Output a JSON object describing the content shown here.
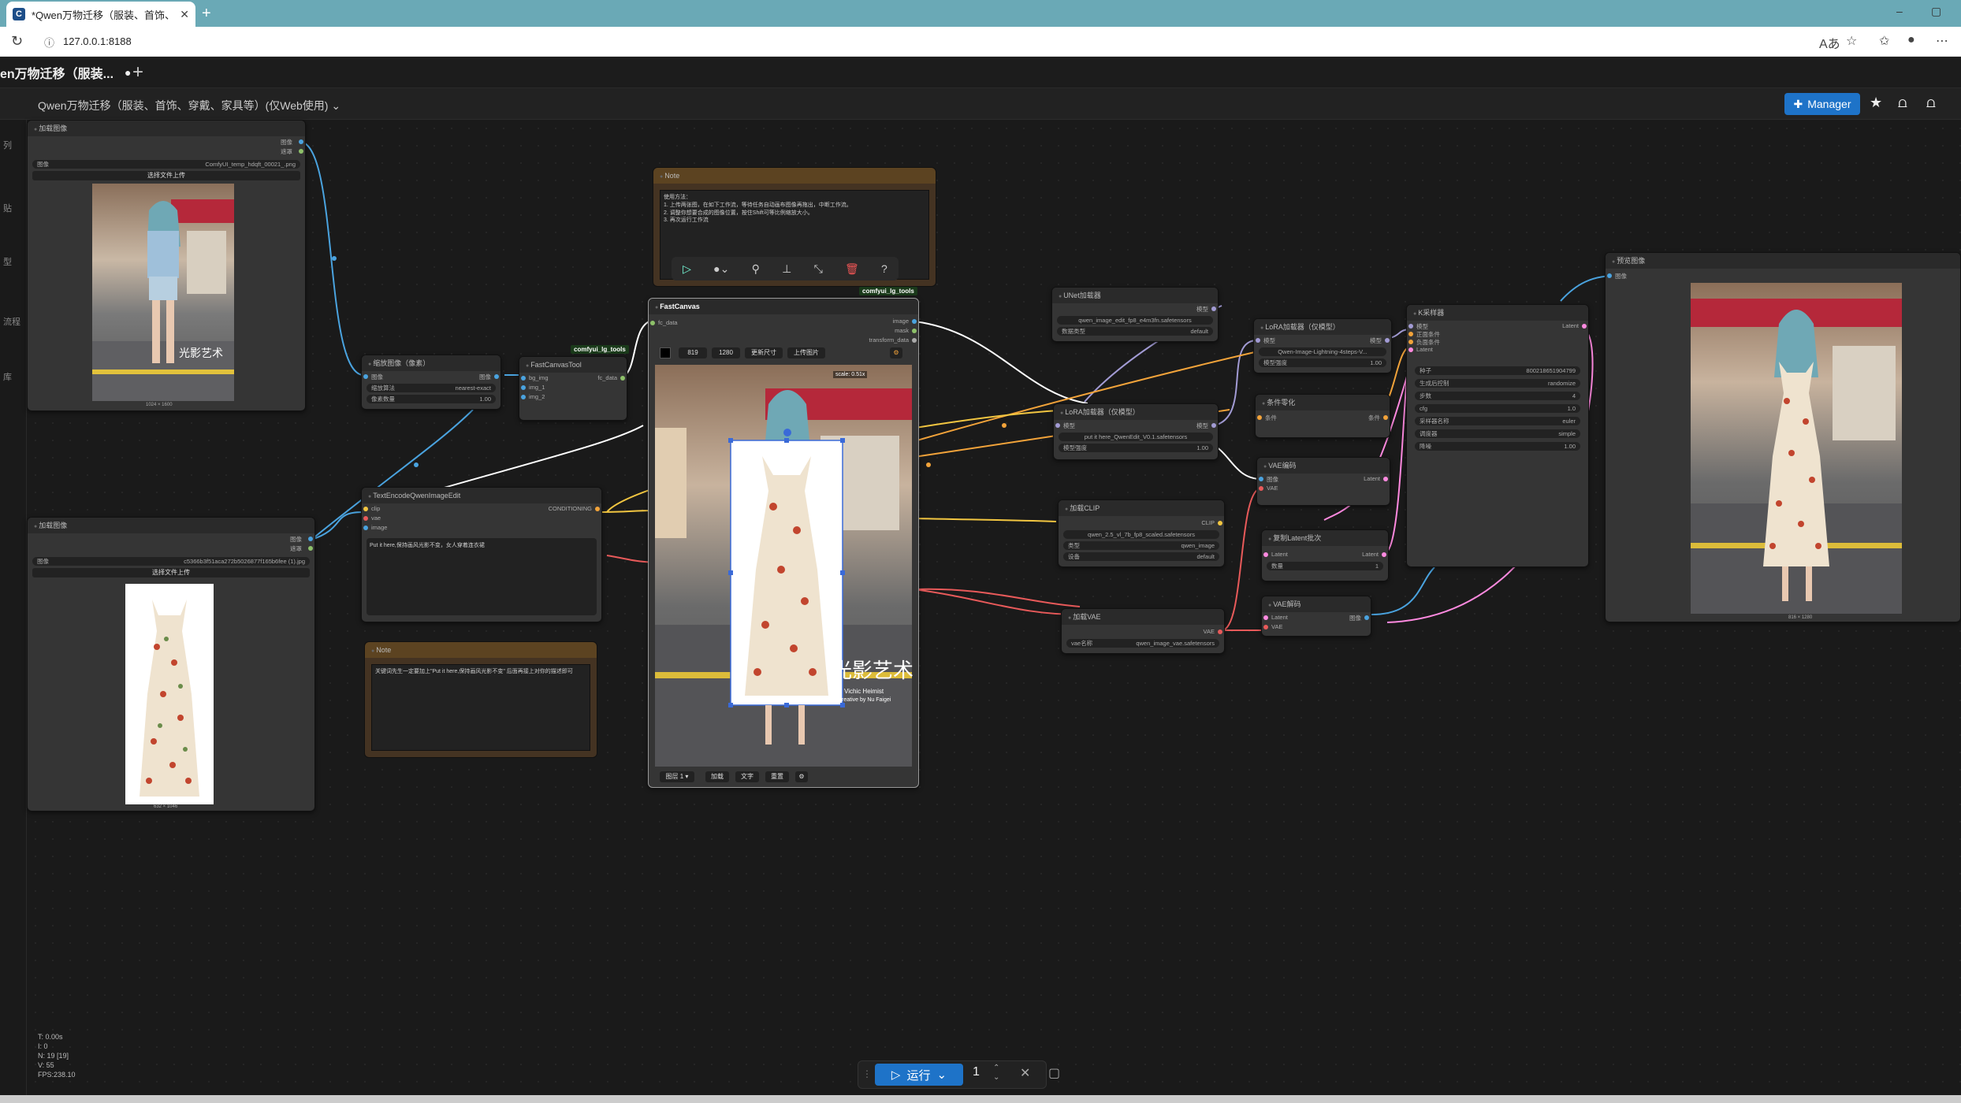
{
  "browser": {
    "tab_title": "*Qwen万物迁移（服装、首饰、多",
    "tab_icon": "C",
    "url": "127.0.0.1:8188",
    "new_tab": "+",
    "close": "✕",
    "minimize": "–",
    "maximize": "▢"
  },
  "app": {
    "workflow_tab": "en万物迁移（服装...",
    "workflow_tab_dot": "●",
    "add_tab": "+",
    "workflow_title": "Qwen万物迁移（服装、首饰、穿戴、家具等）(仅Web使用) ⌄",
    "manager_label": "Manager",
    "left_icons": [
      "列",
      "贴",
      "型",
      "流程",
      "库"
    ],
    "colors": {
      "accent": "#1e73c8",
      "canvas": "#1a1a1a",
      "node": "#353535"
    }
  },
  "nodes": {
    "load1": {
      "title": "加载图像",
      "out1": "图像",
      "out2": "遮罩",
      "file_label": "图像",
      "file": "ComfyUI_temp_hdqft_00021_.png",
      "upload": "选择文件上传",
      "dims": "1024 × 1600"
    },
    "load2": {
      "title": "加载图像",
      "out1": "图像",
      "out2": "遮罩",
      "file_label": "图像",
      "file": "c5366b3f51aca272b5026877f165b6fee (1).jpg",
      "upload": "选择文件上传",
      "dims": "632 × 1046"
    },
    "scale": {
      "title": "缩放图像（像素）",
      "in": "图像",
      "out": "图像",
      "w1l": "缩放算法",
      "w1v": "nearest-exact",
      "w2l": "像素数量",
      "w2v": "1.00"
    },
    "fctool": {
      "title": "FastCanvasTool",
      "tag": "comfyui_lg_tools",
      "in1": "bg_img",
      "in2": "img_1",
      "in3": "img_2",
      "out": "fc_data"
    },
    "encode": {
      "title": "TextEncodeQwenImageEdit",
      "in1": "clip",
      "in2": "vae",
      "in3": "image",
      "out": "CONDITIONING",
      "text": "Put it here,保持画风光影不变，女人穿着连衣裙"
    },
    "note1": {
      "title": "Note",
      "text": "使用方法：\n1. 上传两张图，在如下工作流，等待任务自动画布图像再拖出，中断工作流。\n2. 调整你想要合成的图像位置，按住Shift可等比例缩放大小。\n3. 再次运行工作流"
    },
    "note2": {
      "title": "Note",
      "text": "关键词先生一定要加上\"Put it here,保持画风光影不变\" 后面再接上对你的描述即可"
    },
    "fastcanvas": {
      "title": "FastCanvas",
      "tag": "comfyui_lg_tools",
      "in": "fc_data",
      "out1": "image",
      "out2": "mask",
      "out3": "transform_data",
      "width": "819",
      "height": "1280",
      "btn_resize": "更新尺寸",
      "btn_upload": "上传图片",
      "scale": "scale: 0.51x",
      "layer": "图层 1 ▾",
      "btn_add": "加载",
      "btn_text": "文字",
      "btn_reset": "重置",
      "btn_settings": "⚙",
      "watermark": "光影艺术",
      "wm_sub1": "Vichic Heimist",
      "wm_sub2": "Creative by Nu Faigei"
    },
    "unet": {
      "title": "UNet加载器",
      "out": "模型",
      "w1": "qwen_image_edit_fp8_e4m3fn.safetensors",
      "w2l": "数据类型",
      "w2v": "default"
    },
    "lora1": {
      "title": "LoRA加载器（仅模型）",
      "in": "模型",
      "out": "模型",
      "w1": "Qwen-Image-Lightning-4steps-V...",
      "w2l": "模型强度",
      "w2v": "1.00"
    },
    "lora2": {
      "title": "LoRA加载器（仅模型）",
      "in": "模型",
      "out": "模型",
      "w1": "put it here_QwenEdit_V0.1.safetensors",
      "w2l": "模型强度",
      "w2v": "1.00"
    },
    "zero": {
      "title": "条件零化",
      "in": "条件",
      "out": "条件"
    },
    "vaeenc": {
      "title": "VAE编码",
      "in1": "图像",
      "in2": "VAE",
      "out": "Latent"
    },
    "clip": {
      "title": "加载CLIP",
      "out": "CLIP",
      "w1": "qwen_2.5_vl_7b_fp8_scaled.safetensors",
      "w2l": "类型",
      "w2v": "qwen_image",
      "w3l": "设备",
      "w3v": "default"
    },
    "repeat": {
      "title": "复制Latent批次",
      "in": "Latent",
      "out": "Latent",
      "wl": "数量",
      "wv": "1"
    },
    "vaeload": {
      "title": "加载VAE",
      "out": "VAE",
      "wl": "vae名称",
      "wv": "qwen_image_vae.safetensors"
    },
    "vaedec": {
      "title": "VAE解码",
      "in1": "Latent",
      "in2": "VAE",
      "out": "图像"
    },
    "ksampler": {
      "title": "K采样器",
      "in1": "模型",
      "in2": "正面条件",
      "in3": "负面条件",
      "in4": "Latent",
      "out": "Latent",
      "w": [
        [
          "种子",
          "800218651904799"
        ],
        [
          "生成后控制",
          "randomize"
        ],
        [
          "步数",
          "4"
        ],
        [
          "cfg",
          "1.0"
        ],
        [
          "采样器名称",
          "euler"
        ],
        [
          "调度器",
          "simple"
        ],
        [
          "降噪",
          "1.00"
        ]
      ]
    },
    "preview": {
      "title": "预览图像",
      "in": "图像",
      "dims": "816 × 1280"
    }
  },
  "toolbar": {
    "run": "运行",
    "queue": "1",
    "clear": "✕",
    "stop": "▢"
  },
  "stats": [
    "T: 0.00s",
    "I: 0",
    "N: 19 [19]",
    "V: 55",
    "FPS:238.10"
  ]
}
